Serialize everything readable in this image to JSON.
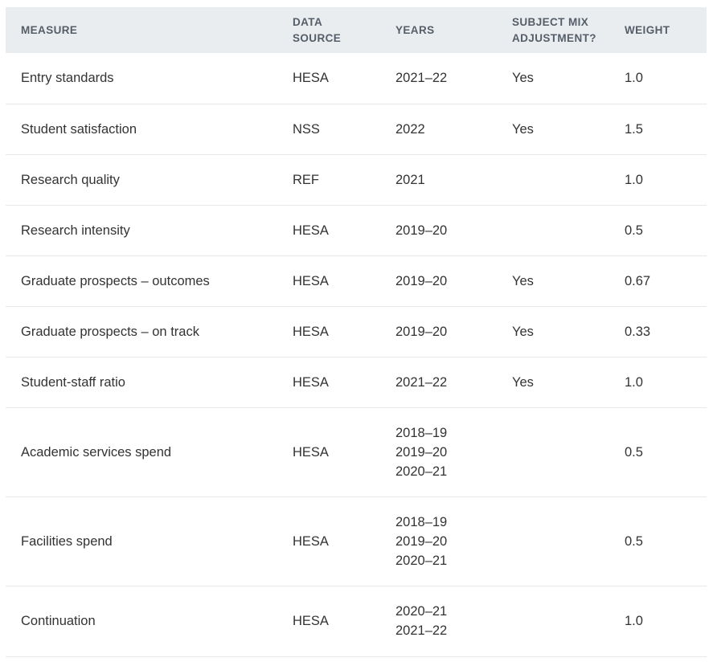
{
  "table": {
    "headers": [
      [
        "MEASURE"
      ],
      [
        "DATA",
        "SOURCE"
      ],
      [
        "YEARS"
      ],
      [
        "SUBJECT MIX",
        "ADJUSTMENT?"
      ],
      [
        "WEIGHT"
      ]
    ],
    "rows": [
      {
        "measure": "Entry standards",
        "source": "HESA",
        "years": [
          "2021–22"
        ],
        "adjustment": "Yes",
        "weight": "1.0"
      },
      {
        "measure": "Student satisfaction",
        "source": "NSS",
        "years": [
          "2022"
        ],
        "adjustment": "Yes",
        "weight": "1.5"
      },
      {
        "measure": "Research quality",
        "source": "REF",
        "years": [
          "2021"
        ],
        "adjustment": "",
        "weight": "1.0"
      },
      {
        "measure": "Research intensity",
        "source": "HESA",
        "years": [
          "2019–20"
        ],
        "adjustment": "",
        "weight": "0.5"
      },
      {
        "measure": "Graduate prospects – outcomes",
        "source": "HESA",
        "years": [
          "2019–20"
        ],
        "adjustment": "Yes",
        "weight": "0.67"
      },
      {
        "measure": "Graduate prospects – on track",
        "source": "HESA",
        "years": [
          "2019–20"
        ],
        "adjustment": "Yes",
        "weight": "0.33"
      },
      {
        "measure": "Student-staff ratio",
        "source": "HESA",
        "years": [
          "2021–22"
        ],
        "adjustment": "Yes",
        "weight": "1.0"
      },
      {
        "measure": "Academic services spend",
        "source": "HESA",
        "years": [
          "2018–19",
          "2019–20",
          "2020–21"
        ],
        "adjustment": "",
        "weight": "0.5"
      },
      {
        "measure": "Facilities spend",
        "source": "HESA",
        "years": [
          "2018–19",
          "2019–20",
          "2020–21"
        ],
        "adjustment": "",
        "weight": "0.5"
      },
      {
        "measure": "Continuation",
        "source": "HESA",
        "years": [
          "2020–21",
          "2021–22"
        ],
        "adjustment": "",
        "weight": "1.0"
      }
    ]
  }
}
